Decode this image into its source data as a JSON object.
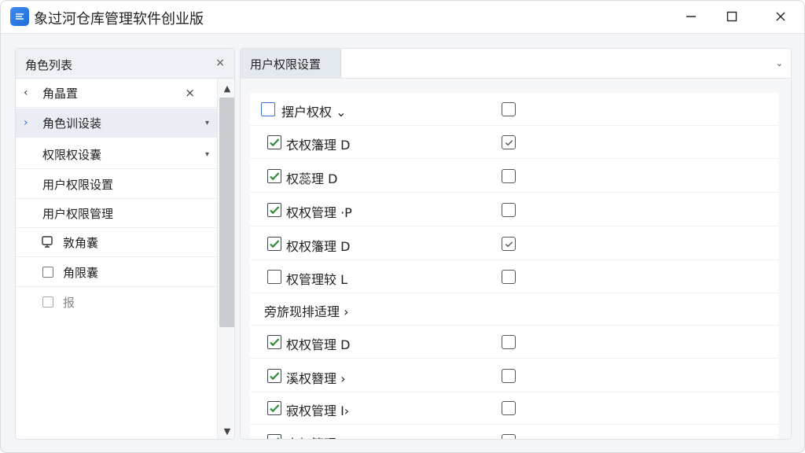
{
  "window": {
    "title": "象过河仓库管理软件创业版",
    "controls": [
      "minimize",
      "maximize",
      "close"
    ]
  },
  "left_panel": {
    "header_title": "角色列表",
    "header_close": "×",
    "items": [
      {
        "label": "角晶置",
        "prefix": "‹",
        "suffix": "×"
      },
      {
        "label": "角色训设装",
        "prefix": "›",
        "suffix": "▾",
        "selected": true
      },
      {
        "label": "权限权设囊",
        "suffix": "▾"
      },
      {
        "label": "用户权限设置"
      },
      {
        "label": "用户权限管理"
      },
      {
        "label": "敦角囊",
        "icon": "device-icon"
      },
      {
        "label": "角限囊",
        "icon": "checkbox-icon"
      },
      {
        "label": "报",
        "icon": "checkbox-icon",
        "faint": true
      }
    ],
    "scroll_up": "▲",
    "scroll_down": "▼"
  },
  "right_panel": {
    "tab_label": "用户权限设置",
    "dropdown_icon": "chevron-down-icon",
    "rows": [
      {
        "label": "摆户权权 ⌄",
        "checked": false,
        "col2": false,
        "kind": "header"
      },
      {
        "label": "衣权籓理 D",
        "checked": true,
        "col2": true
      },
      {
        "label": "权蕊理 D",
        "checked": true,
        "col2": false
      },
      {
        "label": "权权管理 ·P",
        "checked": true,
        "col2": false
      },
      {
        "label": "权权籓理 D",
        "checked": true,
        "col2": true
      },
      {
        "label": "权管理较 Ⅼ",
        "checked": false,
        "col2": false
      },
      {
        "label": "旁旂现排适理 ›",
        "kind": "group"
      },
      {
        "label": "权权管理 D",
        "checked": true,
        "col2": false
      },
      {
        "label": "溪权簪理 ›",
        "checked": true,
        "col2": false
      },
      {
        "label": "寂权管理 I›",
        "checked": true,
        "col2": false
      },
      {
        "label": "寂权管理 D",
        "checked": true,
        "col2": false
      }
    ]
  },
  "colors": {
    "accent": "#2f6fd8",
    "check": "#2e8b3a"
  }
}
